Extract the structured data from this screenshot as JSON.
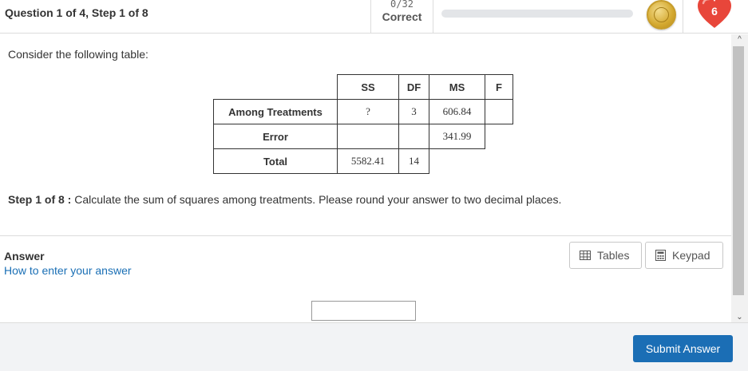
{
  "header": {
    "question_label": "Question 1 of 4, Step 1 of 8",
    "score_fraction": "0/32",
    "score_status": "Correct",
    "progress_fraction": 0,
    "hearts": "6"
  },
  "question": {
    "intro": "Consider the following table:",
    "table": {
      "columns": [
        "SS",
        "DF",
        "MS",
        "F"
      ],
      "rows": [
        {
          "label": "Among Treatments",
          "ss": "?",
          "df": "3",
          "ms": "606.84",
          "f": ""
        },
        {
          "label": "Error",
          "ss": "",
          "df": "",
          "ms": "341.99"
        },
        {
          "label": "Total",
          "ss": "5582.41",
          "df": "14"
        }
      ]
    },
    "step_label": "Step 1 of 8 :",
    "step_text": "Calculate the sum of squares among treatments. Please round your answer to two decimal places."
  },
  "answer": {
    "title": "Answer",
    "howto_link": "How to enter your answer",
    "tables_button": "Tables",
    "keypad_button": "Keypad",
    "input_value": ""
  },
  "footer": {
    "submit_label": "Submit Answer"
  },
  "colors": {
    "accent": "#1b6eb5",
    "link": "#1a6fb5",
    "heart": "#e8463a",
    "coin": "#d4a930"
  }
}
